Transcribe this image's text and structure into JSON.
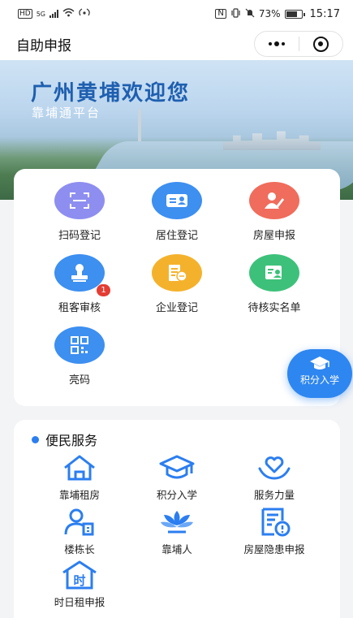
{
  "status_bar": {
    "left_label": "HD",
    "net": "5G",
    "battery": "73%",
    "time": "15:17"
  },
  "nav": {
    "title": "自助申报"
  },
  "banner": {
    "title": "广州黄埔欢迎您",
    "subtitle": "靠埔通平台"
  },
  "main_grid": [
    {
      "label": "扫码登记",
      "icon": "scan-icon",
      "color": "#8e8ef0"
    },
    {
      "label": "居住登记",
      "icon": "id-card-icon",
      "color": "#3d8ff0"
    },
    {
      "label": "房屋申报",
      "icon": "user-edit-icon",
      "color": "#f06c5c"
    },
    {
      "label": "租客审核",
      "icon": "stamp-icon",
      "color": "#3d8ff0",
      "badge": "1"
    },
    {
      "label": "企业登记",
      "icon": "business-icon",
      "color": "#f4b22c"
    },
    {
      "label": "待核实名单",
      "icon": "id-list-icon",
      "color": "#3dc17a"
    },
    {
      "label": "亮码",
      "icon": "qr-code-icon",
      "color": "#3d8ff0"
    }
  ],
  "services": {
    "title": "便民服务",
    "items": [
      {
        "label": "靠埔租房",
        "icon": "house-icon"
      },
      {
        "label": "积分入学",
        "icon": "graduation-cap-icon"
      },
      {
        "label": "服务力量",
        "icon": "heart-hands-icon"
      },
      {
        "label": "楼栋长",
        "icon": "person-building-icon"
      },
      {
        "label": "靠埔人",
        "icon": "lotus-icon"
      },
      {
        "label": "房屋隐患申报",
        "icon": "alert-document-icon"
      },
      {
        "label": "时日租申报",
        "icon": "time-house-icon"
      }
    ]
  },
  "fab": {
    "label": "积分入学",
    "icon": "graduation-cap-icon"
  }
}
